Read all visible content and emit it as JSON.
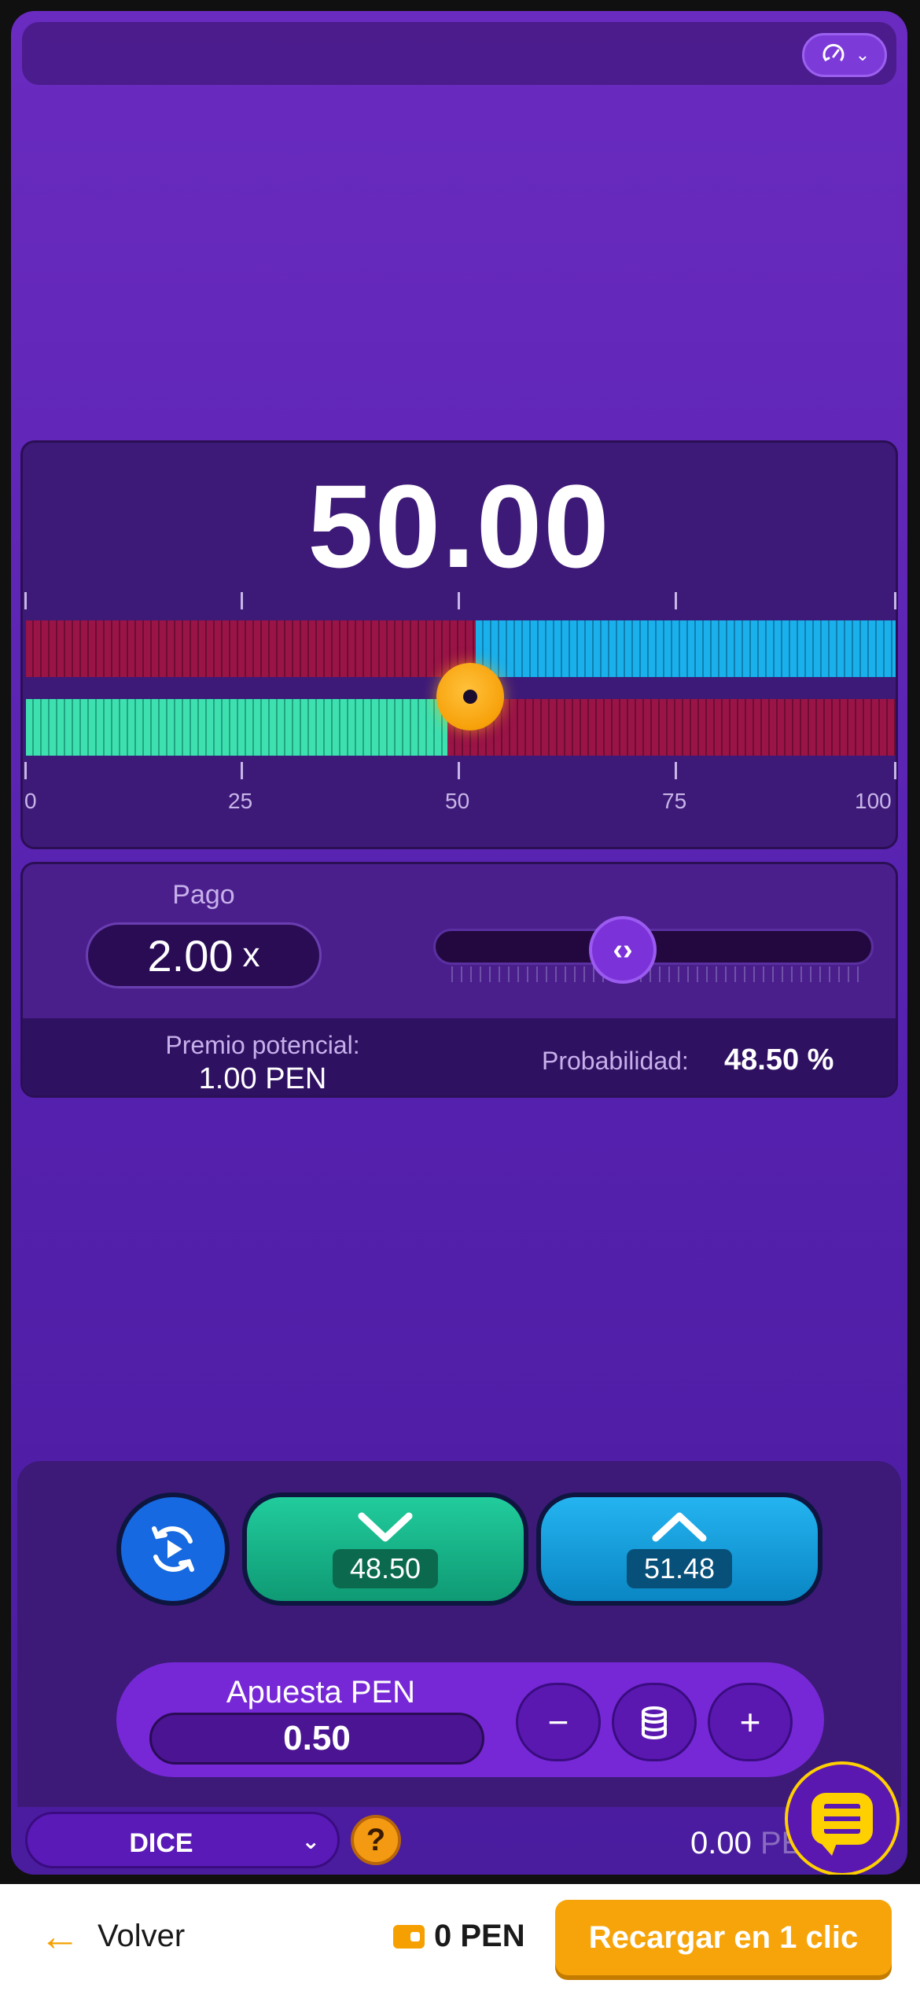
{
  "header": {
    "history_icon": "history-speedometer-icon",
    "history_chevron": "⌄"
  },
  "result": {
    "value": "50.00",
    "scale": [
      "0",
      "25",
      "50",
      "75",
      "100"
    ],
    "roll_position_percent": 50,
    "colors": {
      "red": "#9a1447",
      "blue": "#1ab0ec",
      "green": "#3ee0b0",
      "knob": "#f7a10a"
    }
  },
  "payout": {
    "pago_label": "Pago",
    "pago_value": "2.00",
    "pago_unit": "x",
    "slider_thumb_icon": "‹›",
    "slider_position_percent": 48.5,
    "premio_label": "Premio potencial:",
    "premio_value": "1.00 PEN",
    "prob_label": "Probabilidad:",
    "prob_value": "48.50 %"
  },
  "controls": {
    "autoplay_icon": "autoplay-refresh-icon",
    "under_value": "48.50",
    "over_value": "51.48",
    "bet_label": "Apuesta PEN",
    "bet_value": "0.50",
    "minus": "−",
    "plus": "+",
    "coins_icon": "coins-stack-icon"
  },
  "gamebar": {
    "game_name": "DICE",
    "game_chevron": "⌄",
    "help": "?",
    "balance_value": "0.00",
    "balance_currency": "PEN"
  },
  "footer": {
    "back_arrow": "←",
    "back_label": "Volver",
    "wallet_value": "0 PEN",
    "reload_label": "Recargar en 1 clic"
  }
}
